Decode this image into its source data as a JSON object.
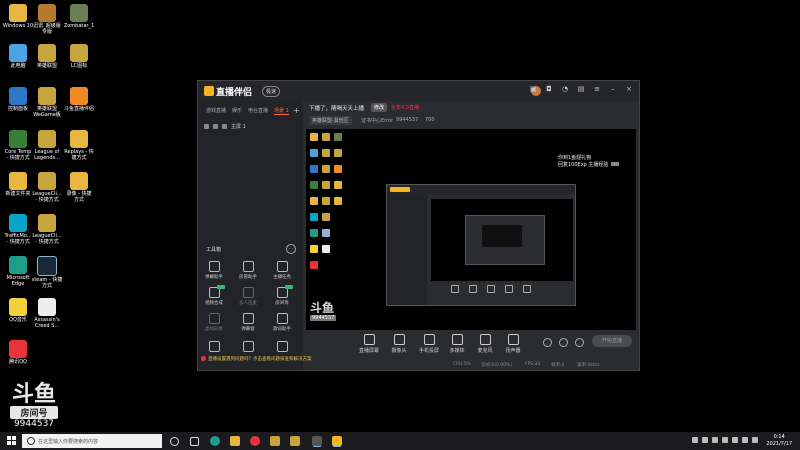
{
  "desktop": {
    "icons": [
      {
        "label": "Windows 10",
        "icon": "folder-icon",
        "color": "#e8b640"
      },
      {
        "label": "迅雷_超级版\n专版",
        "icon": "game-icon",
        "color": "#b57a2e"
      },
      {
        "label": "Zombatar_1",
        "icon": "zombatar-icon",
        "color": "#6b7d52"
      },
      {
        "label": "此电脑",
        "icon": "pc-icon",
        "color": "#4ba3e3"
      },
      {
        "label": "英雄联盟",
        "icon": "lol-icon",
        "color": "#c8a53c"
      },
      {
        "label": "LC图标",
        "icon": "lol-icon",
        "color": "#c8a53c"
      },
      {
        "label": "控制面板",
        "icon": "control-panel-icon",
        "color": "#2d77c9"
      },
      {
        "label": "英雄联盟\nWeGame版",
        "icon": "lol-icon",
        "color": "#c8a53c"
      },
      {
        "label": "斗鱼直播伴侣",
        "icon": "question-icon",
        "color": "#f08a24"
      },
      {
        "label": "Core Temp\n- 快捷方式",
        "icon": "cpu-icon",
        "color": "#3a7e3a"
      },
      {
        "label": "League of\nLegends...",
        "icon": "lol-icon",
        "color": "#c8a53c"
      },
      {
        "label": "Replays - 快\n捷方式",
        "icon": "folder-icon",
        "color": "#e8b640"
      },
      {
        "label": "新建文件夹",
        "icon": "folder-icon",
        "color": "#e8b640"
      },
      {
        "label": "LeagueCli...\n- 快捷方式",
        "icon": "lol-icon",
        "color": "#c8a53c"
      },
      {
        "label": "录像 - 快捷\n方式",
        "icon": "folder-icon",
        "color": "#e8b640"
      },
      {
        "label": "TrafficMo...\n- 快捷方式",
        "icon": "traffic-icon",
        "color": "#0aa3c9"
      },
      {
        "label": "LeagueCli...\n- 快捷方式",
        "icon": "lol-icon",
        "color": "#c8a53c"
      },
      {
        "label": "Microsoft\nEdge",
        "icon": "edge-icon",
        "color": "#1f9d8b"
      },
      {
        "label": "steam - 快捷\n方式",
        "icon": "steam-icon",
        "color": "#1b2838"
      },
      {
        "label": "QQ音乐",
        "icon": "qq-music-icon",
        "color": "#f2d13a"
      },
      {
        "label": "Assassin's\nCreed S...",
        "icon": "document-icon",
        "color": "#eeeeee"
      },
      {
        "label": "腾讯QQ",
        "icon": "tencent-qq-icon",
        "color": "#e8333b"
      }
    ],
    "douyu": {
      "logo": "斗鱼",
      "room_label": "房间号",
      "room_id": "9944537"
    }
  },
  "window": {
    "app_name": "直播伴侣",
    "app_tag": "极速",
    "tabs": [
      "游戏直播",
      "娱乐",
      "电台直播",
      "场景 1"
    ],
    "scene_label": "主屏 1",
    "room_title": "下播了，随喝天天上播",
    "edit_label": "修改",
    "room_tags": "全年4.0直播",
    "category": "英雄联盟-其他区",
    "stats": [
      "证书中心Error",
      "9944537",
      "700"
    ],
    "tools_title": "工具箱",
    "tools": [
      {
        "label": "弹幕助手",
        "dim": false,
        "badge": false
      },
      {
        "label": "房管助手",
        "dim": false,
        "badge": false
      },
      {
        "label": "主播任务",
        "dim": false,
        "badge": false
      },
      {
        "label": "视频合成",
        "dim": false,
        "badge": true
      },
      {
        "label": "多人连麦",
        "dim": true,
        "badge": false
      },
      {
        "label": "房间等",
        "dim": false,
        "badge": true
      },
      {
        "label": "虚拟形象",
        "dim": true,
        "badge": false
      },
      {
        "label": "弹幕窗",
        "dim": false,
        "badge": false
      },
      {
        "label": "歌词助手",
        "dim": false,
        "badge": false
      }
    ],
    "preview_note": [
      "你到1鱼翅礼物",
      "回复100Exp 主播经验"
    ],
    "controls": [
      {
        "label": "直播屏幕",
        "icon": "screen-icon"
      },
      {
        "label": "摄像头",
        "icon": "camera-icon"
      },
      {
        "label": "手机投屏",
        "icon": "phone-cast-icon"
      },
      {
        "label": "多媒体",
        "icon": "media-icon"
      },
      {
        "label": "麦克风",
        "icon": "mic-icon"
      },
      {
        "label": "扬声器",
        "icon": "speaker-icon"
      }
    ],
    "start_label": "开始直播",
    "status": [
      "CPU:5%",
      "丢帧:0(0.00%)",
      "FPS:30",
      "帧率:0",
      "速率:0kb/s"
    ],
    "notice": "直播设置遇到问题吗？点击查看问题排查和解决方案"
  },
  "taskbar": {
    "search_placeholder": "在这里输入你要搜索的内容",
    "time": "0:14",
    "date": "2021/7/17"
  }
}
